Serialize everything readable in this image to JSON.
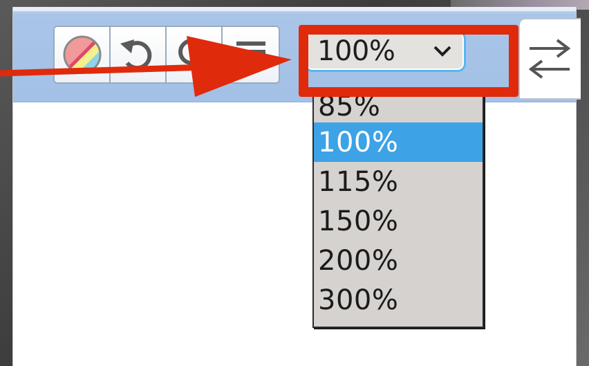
{
  "toolbar": {
    "buttons": [
      {
        "name": "color-filter-button",
        "icon": "color-wheel-icon"
      },
      {
        "name": "undo-button",
        "icon": "undo-icon"
      },
      {
        "name": "search-button",
        "icon": "magnifier-icon"
      },
      {
        "name": "list-button",
        "icon": "list-icon"
      }
    ],
    "zoom": {
      "selected": "100%",
      "options": [
        "85%",
        "100%",
        "115%",
        "150%",
        "200%",
        "300%"
      ],
      "highlighted_option": "100%"
    },
    "swap_icon": "swap-arrows-icon"
  },
  "annotation": {
    "color": "#e02a0c",
    "highlight_target": "zoom-combo"
  },
  "colors": {
    "toolbar": "#a3c0e6",
    "selection": "#3da2e6",
    "focus_ring": "#59b6f0",
    "dropdown_bg": "#d5d2cf"
  }
}
